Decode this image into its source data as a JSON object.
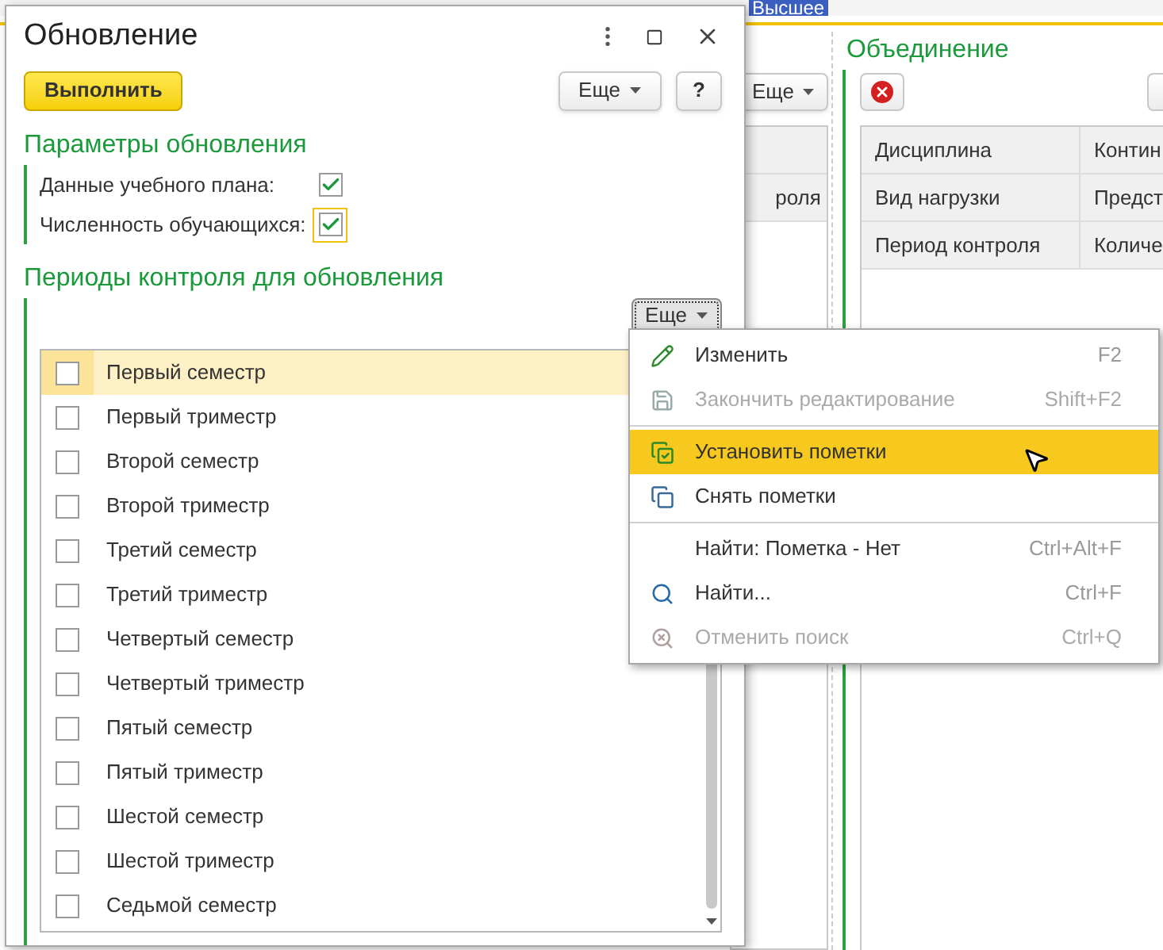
{
  "background": {
    "top_highlight": "Высшее",
    "left_panel": {
      "more_button": "Еще",
      "cells": [
        "роля"
      ]
    },
    "right_panel": {
      "title": "Объединение",
      "rows": [
        {
          "label": "Дисциплина",
          "value": "Контин"
        },
        {
          "label": "Вид нагрузки",
          "value": "Предст"
        },
        {
          "label": "Период контроля",
          "value": "Количе"
        }
      ]
    }
  },
  "window": {
    "title": "Обновление"
  },
  "toolbar": {
    "run_button": "Выполнить",
    "more_button": "Еще",
    "help_button": "?"
  },
  "update_params": {
    "title": "Параметры обновления",
    "fields": [
      {
        "label": "Данные учебного плана:",
        "checked": true,
        "focused": false
      },
      {
        "label": "Численность обучающихся:",
        "checked": true,
        "focused": true
      }
    ]
  },
  "periods": {
    "title": "Периоды контроля для обновления",
    "more_button": "Еще",
    "rows": [
      {
        "label": "Первый семестр",
        "checked": false,
        "selected": true
      },
      {
        "label": "Первый триместр",
        "checked": false,
        "selected": false
      },
      {
        "label": "Второй семестр",
        "checked": false,
        "selected": false
      },
      {
        "label": "Второй триместр",
        "checked": false,
        "selected": false
      },
      {
        "label": "Третий семестр",
        "checked": false,
        "selected": false
      },
      {
        "label": "Третий триместр",
        "checked": false,
        "selected": false
      },
      {
        "label": "Четвертый семестр",
        "checked": false,
        "selected": false
      },
      {
        "label": "Четвертый триместр",
        "checked": false,
        "selected": false
      },
      {
        "label": "Пятый семестр",
        "checked": false,
        "selected": false
      },
      {
        "label": "Пятый триместр",
        "checked": false,
        "selected": false
      },
      {
        "label": "Шестой семестр",
        "checked": false,
        "selected": false
      },
      {
        "label": "Шестой триместр",
        "checked": false,
        "selected": false
      },
      {
        "label": "Седьмой семестр",
        "checked": false,
        "selected": false
      }
    ]
  },
  "context_menu": {
    "items": [
      {
        "kind": "item",
        "label": "Изменить",
        "shortcut": "F2",
        "disabled": false,
        "selected": false
      },
      {
        "kind": "item",
        "label": "Закончить редактирование",
        "shortcut": "Shift+F2",
        "disabled": true,
        "selected": false
      },
      {
        "kind": "separator"
      },
      {
        "kind": "item",
        "label": "Установить пометки",
        "disabled": false,
        "selected": true
      },
      {
        "kind": "item",
        "label": "Снять пометки",
        "disabled": false,
        "selected": false
      },
      {
        "kind": "separator"
      },
      {
        "kind": "item",
        "label": "Найти: Пометка - Нет",
        "shortcut": "Ctrl+Alt+F",
        "disabled": false,
        "selected": false
      },
      {
        "kind": "item",
        "label": "Найти...",
        "shortcut": "Ctrl+F",
        "disabled": false,
        "selected": false
      },
      {
        "kind": "item",
        "label": "Отменить поиск",
        "shortcut": "Ctrl+Q",
        "disabled": true,
        "selected": false
      }
    ]
  }
}
